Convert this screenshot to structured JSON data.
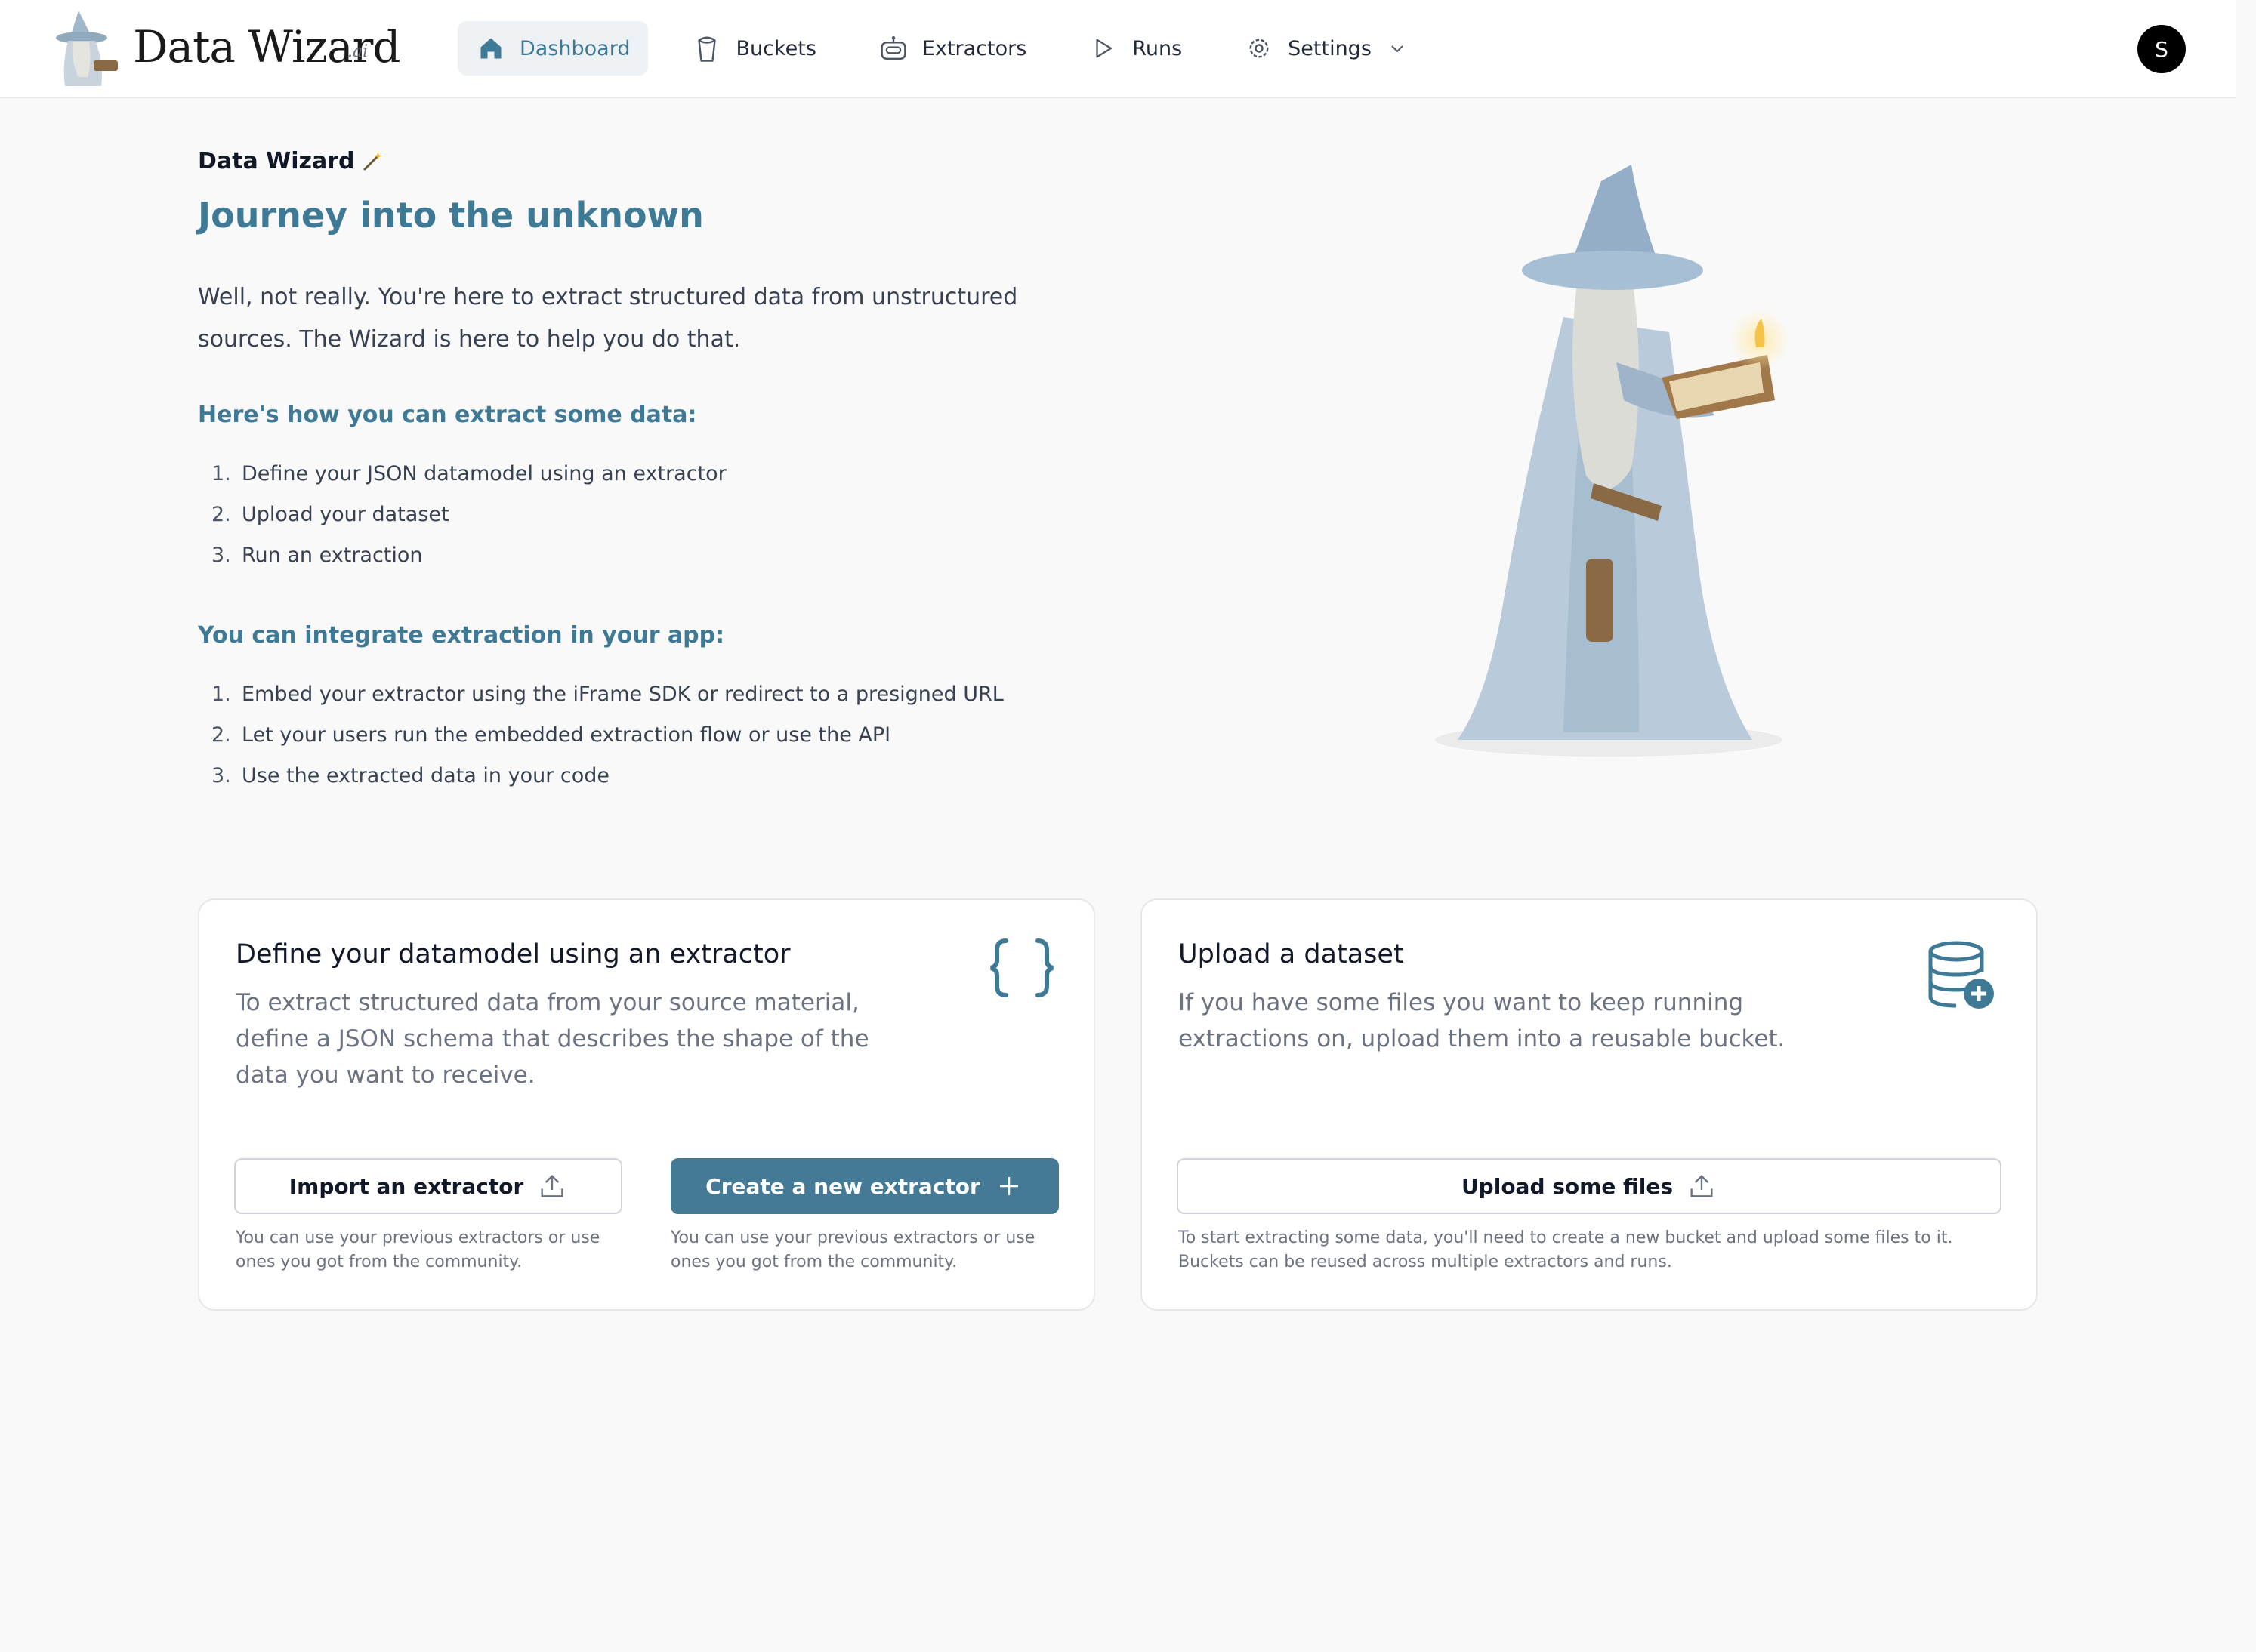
{
  "brand": {
    "name": "Data Wizard",
    "suffix": ".ai"
  },
  "nav": {
    "items": [
      {
        "label": "Dashboard",
        "icon": "home-icon",
        "active": true
      },
      {
        "label": "Buckets",
        "icon": "bucket-icon"
      },
      {
        "label": "Extractors",
        "icon": "robot-icon"
      },
      {
        "label": "Runs",
        "icon": "play-icon"
      },
      {
        "label": "Settings",
        "icon": "gear-icon"
      }
    ],
    "avatar_initial": "S"
  },
  "intro": {
    "eyebrow": "Data Wizard",
    "title": "Journey into the unknown",
    "paragraph": "Well, not really. You're here to extract structured data from unstructured sources. The Wizard is here to help you do that."
  },
  "how_to": {
    "heading": "Here's how you can extract some data:",
    "steps": [
      "Define your JSON datamodel using an extractor",
      "Upload your dataset",
      "Run an extraction"
    ]
  },
  "integrate": {
    "heading": "You can integrate extraction in your app:",
    "steps": [
      "Embed your extractor using the iFrame SDK or redirect to a presigned URL",
      "Let your users run the embedded extraction flow or use the API",
      "Use the extracted data in your code"
    ]
  },
  "extractor_card": {
    "title": "Define your datamodel using an extractor",
    "description": "To extract structured data from your source material, define a JSON schema that describes the shape of the data you want to receive.",
    "import_button": "Import an extractor",
    "import_hint": "You can use your previous extractors or use ones you got from the community.",
    "create_button": "Create a new extractor",
    "create_hint": "You can use your previous extractors or use ones you got from the community."
  },
  "dataset_card": {
    "title": "Upload a dataset",
    "description": "If you have some files you want to keep running extractions on, upload them into a reusable bucket.",
    "upload_button": "Upload some files",
    "upload_hint": "To start extracting some data, you'll need to create a new bucket and upload some files to it. Buckets can be reused across multiple extractors and runs."
  },
  "colors": {
    "accent": "#3e7a96",
    "primary_button": "#447a95",
    "background": "#f9f9f9"
  }
}
